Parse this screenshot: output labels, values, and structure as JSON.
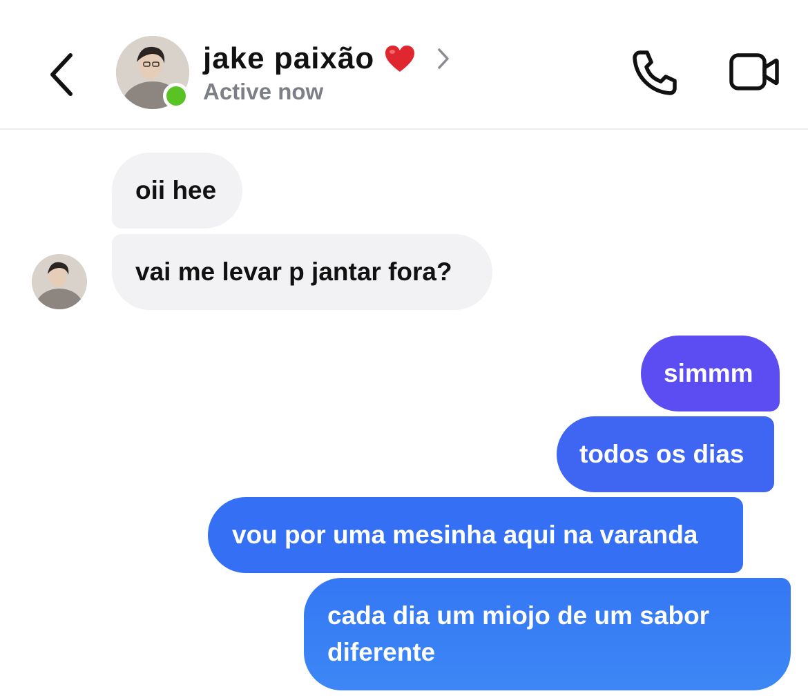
{
  "header": {
    "contact_name": "jake paixão",
    "status": "Active now",
    "heart_icon": "red-heart-emoji",
    "back_icon": "chevron-left-icon",
    "call_icon": "phone-icon",
    "video_icon": "video-camera-icon"
  },
  "colors": {
    "online": "#58c322",
    "incoming_bubble": "#f2f2f4",
    "outgoing_gradient_top": "#5b4cf3",
    "outgoing_gradient_bottom": "#3c86f5"
  },
  "messages": [
    {
      "sender": "contact",
      "text": "oii hee"
    },
    {
      "sender": "contact",
      "text": "vai me levar p jantar fora?"
    },
    {
      "sender": "me",
      "text": "simmm"
    },
    {
      "sender": "me",
      "text": "todos os dias"
    },
    {
      "sender": "me",
      "text": "vou por uma mesinha aqui na varanda"
    },
    {
      "sender": "me",
      "text": "cada dia um miojo de um sabor diferente"
    }
  ]
}
